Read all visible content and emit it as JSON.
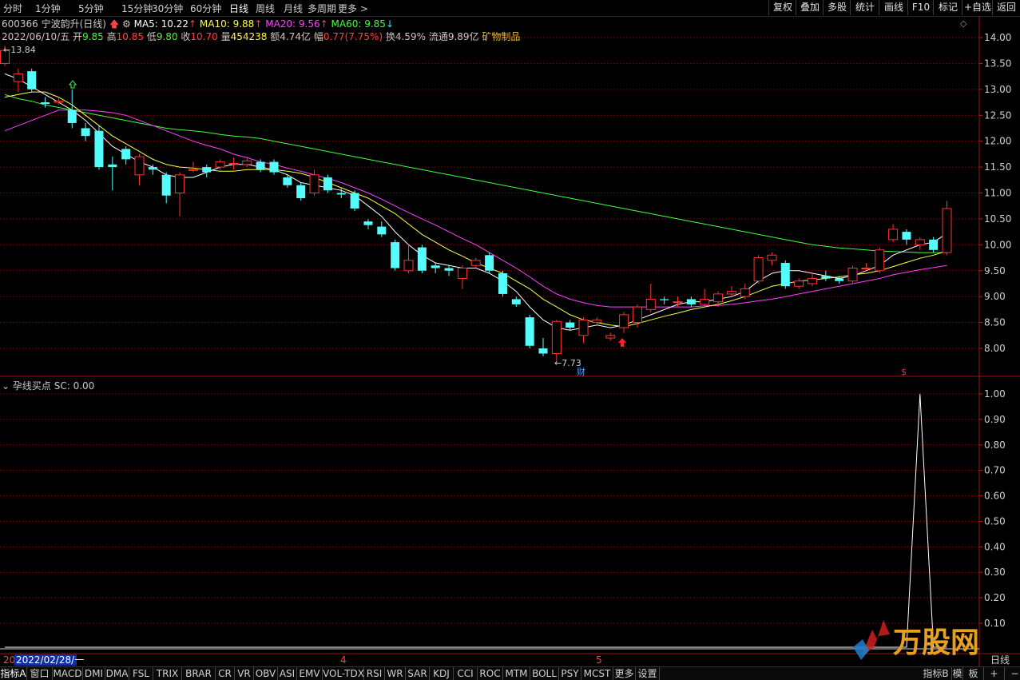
{
  "timeframes": [
    "分时",
    "1分钟",
    "5分钟",
    "15分钟",
    "30分钟",
    "60分钟",
    "日线",
    "周线",
    "月线",
    "多周期",
    "更多 >"
  ],
  "active_timeframe": "日线",
  "right_buttons": [
    "复权",
    "叠加",
    "多股",
    "统计",
    "画线",
    "F10",
    "标记",
    "+自选",
    "返回"
  ],
  "stock": {
    "code_name": "600366 宁波韵升(日线)",
    "ma5": "MA5: 10.22",
    "ma10": "MA10: 9.88",
    "ma20": "MA20: 9.56",
    "ma60": "MA60: 9.85",
    "date": "2022/06/10/五",
    "open_label": "开",
    "open": "9.85",
    "high_label": "高",
    "high": "10.85",
    "low_label": "低",
    "low": "9.80",
    "close_label": "收",
    "close": "10.70",
    "vol_label": "量",
    "vol": "454238",
    "amount_label": "额",
    "amount": "4.74亿",
    "change_label": "幅",
    "change": "0.77(7.75%)",
    "turnover_label": "换",
    "turnover": "4.59%",
    "float_label": "流通",
    "float": "9.89亿",
    "industry": "矿物制品"
  },
  "colors": {
    "up": "#ff3232",
    "down": "#54fcfc",
    "ma5": "#ffffff",
    "ma10": "#ffff40",
    "ma20": "#ff40ff",
    "ma60": "#40ff40",
    "grid": "#8b0000"
  },
  "price_axis": [
    "14.00",
    "13.50",
    "13.00",
    "12.50",
    "12.00",
    "11.50",
    "11.00",
    "10.50",
    "10.00",
    "9.50",
    "9.00",
    "8.50",
    "8.00"
  ],
  "annotations": {
    "high_mark": "13.84",
    "low_mark": "7.73",
    "cai": "财",
    "dollar": "$"
  },
  "indicator": {
    "name": "孕线买点",
    "value_text": "SC: 0.00"
  },
  "indicator_axis": [
    "1.00",
    "0.90",
    "0.80",
    "0.70",
    "0.60",
    "0.50",
    "0.40",
    "0.30",
    "0.20",
    "0.10"
  ],
  "time_axis": {
    "start_left": "20",
    "start_date": "2022/02/28/一",
    "month4": "4",
    "month5": "5",
    "end_label": "日线"
  },
  "tabs": [
    "指标A",
    "窗口",
    "MACD",
    "DMI",
    "DMA",
    "FSL",
    "TRIX",
    "BRAR",
    "CR",
    "VR",
    "OBV",
    "ASI",
    "EMV",
    "VOL-TDX",
    "RSI",
    "WR",
    "SAR",
    "KDJ",
    "CCI",
    "ROC",
    "MTM",
    "BOLL",
    "PSY",
    "MCST",
    "更多",
    "设置"
  ],
  "right_tabs": [
    "指标B",
    "模",
    "板",
    "+",
    "−"
  ],
  "watermark": "万股网",
  "chart_data": {
    "type": "candlestick",
    "candles": [
      {
        "o": 13.5,
        "c": 13.75,
        "h": 13.84,
        "l": 13.45
      },
      {
        "o": 13.15,
        "c": 13.3,
        "h": 13.4,
        "l": 12.95
      },
      {
        "o": 13.35,
        "c": 13.0,
        "h": 13.4,
        "l": 12.95
      },
      {
        "o": 12.75,
        "c": 12.72,
        "h": 12.85,
        "l": 12.65
      },
      {
        "o": 12.75,
        "c": 12.77,
        "h": 12.85,
        "l": 12.7
      },
      {
        "o": 12.6,
        "c": 12.35,
        "h": 13.0,
        "l": 12.25
      },
      {
        "o": 12.25,
        "c": 12.1,
        "h": 12.35,
        "l": 12.0
      },
      {
        "o": 12.2,
        "c": 11.5,
        "h": 12.3,
        "l": 11.45
      },
      {
        "o": 11.55,
        "c": 11.5,
        "h": 11.7,
        "l": 11.05
      },
      {
        "o": 11.85,
        "c": 11.65,
        "h": 11.9,
        "l": 11.55
      },
      {
        "o": 11.35,
        "c": 11.7,
        "h": 11.75,
        "l": 11.15
      },
      {
        "o": 11.5,
        "c": 11.45,
        "h": 11.55,
        "l": 11.35
      },
      {
        "o": 11.35,
        "c": 10.95,
        "h": 11.4,
        "l": 10.8
      },
      {
        "o": 11.0,
        "c": 11.35,
        "h": 11.4,
        "l": 10.55
      },
      {
        "o": 11.45,
        "c": 11.45,
        "h": 11.6,
        "l": 11.4
      },
      {
        "o": 11.5,
        "c": 11.4,
        "h": 11.55,
        "l": 11.3
      },
      {
        "o": 11.5,
        "c": 11.6,
        "h": 11.65,
        "l": 11.45
      },
      {
        "o": 11.57,
        "c": 11.57,
        "h": 11.68,
        "l": 11.45
      },
      {
        "o": 11.55,
        "c": 11.62,
        "h": 11.7,
        "l": 11.5
      },
      {
        "o": 11.6,
        "c": 11.45,
        "h": 11.65,
        "l": 11.4
      },
      {
        "o": 11.6,
        "c": 11.4,
        "h": 11.65,
        "l": 11.35
      },
      {
        "o": 11.3,
        "c": 11.15,
        "h": 11.35,
        "l": 11.1
      },
      {
        "o": 11.15,
        "c": 10.9,
        "h": 11.2,
        "l": 10.85
      },
      {
        "o": 11.0,
        "c": 11.35,
        "h": 11.45,
        "l": 10.95
      },
      {
        "o": 11.3,
        "c": 11.05,
        "h": 11.35,
        "l": 11.0
      },
      {
        "o": 11.0,
        "c": 10.97,
        "h": 11.1,
        "l": 10.9
      },
      {
        "o": 11.0,
        "c": 10.7,
        "h": 11.05,
        "l": 10.65
      },
      {
        "o": 10.45,
        "c": 10.38,
        "h": 10.5,
        "l": 10.3
      },
      {
        "o": 10.35,
        "c": 10.2,
        "h": 10.45,
        "l": 10.15
      },
      {
        "o": 10.05,
        "c": 9.55,
        "h": 10.1,
        "l": 9.5
      },
      {
        "o": 9.5,
        "c": 9.7,
        "h": 10.0,
        "l": 9.45
      },
      {
        "o": 9.95,
        "c": 9.5,
        "h": 10.0,
        "l": 9.45
      },
      {
        "o": 9.6,
        "c": 9.55,
        "h": 9.65,
        "l": 9.45
      },
      {
        "o": 9.55,
        "c": 9.5,
        "h": 9.6,
        "l": 9.4
      },
      {
        "o": 9.35,
        "c": 9.55,
        "h": 9.6,
        "l": 9.15
      },
      {
        "o": 9.6,
        "c": 9.7,
        "h": 9.75,
        "l": 9.55
      },
      {
        "o": 9.8,
        "c": 9.5,
        "h": 9.85,
        "l": 9.45
      },
      {
        "o": 9.45,
        "c": 9.05,
        "h": 9.5,
        "l": 9.0
      },
      {
        "o": 8.95,
        "c": 8.85,
        "h": 9.0,
        "l": 8.8
      },
      {
        "o": 8.6,
        "c": 8.05,
        "h": 8.65,
        "l": 8.0
      },
      {
        "o": 8.0,
        "c": 7.9,
        "h": 8.2,
        "l": 7.85
      },
      {
        "o": 7.9,
        "c": 8.52,
        "h": 8.55,
        "l": 7.73
      },
      {
        "o": 8.5,
        "c": 8.4,
        "h": 8.55,
        "l": 8.35
      },
      {
        "o": 8.25,
        "c": 8.55,
        "h": 8.6,
        "l": 8.1
      },
      {
        "o": 8.5,
        "c": 8.55,
        "h": 8.6,
        "l": 8.45
      },
      {
        "o": 8.2,
        "c": 8.25,
        "h": 8.3,
        "l": 8.15
      },
      {
        "o": 8.4,
        "c": 8.65,
        "h": 8.7,
        "l": 8.3
      },
      {
        "o": 8.5,
        "c": 8.8,
        "h": 8.85,
        "l": 8.4
      },
      {
        "o": 8.75,
        "c": 8.95,
        "h": 9.25,
        "l": 8.7
      },
      {
        "o": 8.95,
        "c": 8.93,
        "h": 9.0,
        "l": 8.85
      },
      {
        "o": 8.9,
        "c": 8.9,
        "h": 9.0,
        "l": 8.8
      },
      {
        "o": 8.95,
        "c": 8.85,
        "h": 9.0,
        "l": 8.8
      },
      {
        "o": 8.85,
        "c": 8.95,
        "h": 9.15,
        "l": 8.8
      },
      {
        "o": 8.9,
        "c": 9.05,
        "h": 9.1,
        "l": 8.8
      },
      {
        "o": 9.05,
        "c": 9.1,
        "h": 9.2,
        "l": 9.0
      },
      {
        "o": 9.0,
        "c": 9.15,
        "h": 9.25,
        "l": 8.95
      },
      {
        "o": 9.3,
        "c": 9.75,
        "h": 9.8,
        "l": 9.25
      },
      {
        "o": 9.7,
        "c": 9.8,
        "h": 9.85,
        "l": 9.6
      },
      {
        "o": 9.65,
        "c": 9.2,
        "h": 9.7,
        "l": 9.15
      },
      {
        "o": 9.2,
        "c": 9.3,
        "h": 9.35,
        "l": 9.15
      },
      {
        "o": 9.25,
        "c": 9.35,
        "h": 9.45,
        "l": 9.2
      },
      {
        "o": 9.4,
        "c": 9.35,
        "h": 9.5,
        "l": 9.3
      },
      {
        "o": 9.35,
        "c": 9.3,
        "h": 9.4,
        "l": 9.25
      },
      {
        "o": 9.3,
        "c": 9.55,
        "h": 9.6,
        "l": 9.25
      },
      {
        "o": 9.55,
        "c": 9.55,
        "h": 9.65,
        "l": 9.5
      },
      {
        "o": 9.5,
        "c": 9.9,
        "h": 9.95,
        "l": 9.45
      },
      {
        "o": 10.1,
        "c": 10.3,
        "h": 10.4,
        "l": 10.05
      },
      {
        "o": 10.25,
        "c": 10.1,
        "h": 10.3,
        "l": 10.0
      },
      {
        "o": 10.0,
        "c": 10.1,
        "h": 10.15,
        "l": 9.9
      },
      {
        "o": 10.1,
        "c": 9.9,
        "h": 10.15,
        "l": 9.85
      },
      {
        "o": 9.85,
        "c": 10.7,
        "h": 10.85,
        "l": 9.8
      }
    ],
    "ma5": [
      13.3,
      13.2,
      13.05,
      12.9,
      12.75,
      12.6,
      12.4,
      12.15,
      11.9,
      11.75,
      11.6,
      11.5,
      11.35,
      11.3,
      11.3,
      11.4,
      11.5,
      11.55,
      11.55,
      11.5,
      11.45,
      11.35,
      11.2,
      11.15,
      11.1,
      11.05,
      10.95,
      10.75,
      10.55,
      10.25,
      10.0,
      9.8,
      9.65,
      9.6,
      9.55,
      9.55,
      9.45,
      9.3,
      9.1,
      8.8,
      8.55,
      8.4,
      8.35,
      8.4,
      8.45,
      8.4,
      8.45,
      8.55,
      8.65,
      8.75,
      8.85,
      8.9,
      8.9,
      8.95,
      9.0,
      9.1,
      9.3,
      9.45,
      9.5,
      9.5,
      9.45,
      9.4,
      9.35,
      9.4,
      9.5,
      9.6,
      9.8,
      9.9,
      10.0,
      10.05,
      10.22
    ],
    "ma10": [
      12.85,
      12.9,
      12.95,
      12.95,
      12.85,
      12.7,
      12.5,
      12.3,
      12.1,
      11.95,
      11.8,
      11.65,
      11.55,
      11.5,
      11.48,
      11.45,
      11.42,
      11.42,
      11.45,
      11.45,
      11.45,
      11.42,
      11.38,
      11.3,
      11.2,
      11.1,
      11.0,
      10.9,
      10.75,
      10.6,
      10.4,
      10.2,
      10.05,
      9.9,
      9.78,
      9.65,
      9.55,
      9.45,
      9.3,
      9.15,
      8.95,
      8.8,
      8.65,
      8.55,
      8.5,
      8.45,
      8.42,
      8.48,
      8.55,
      8.62,
      8.68,
      8.75,
      8.8,
      8.85,
      8.92,
      9.0,
      9.1,
      9.2,
      9.25,
      9.3,
      9.32,
      9.35,
      9.38,
      9.42,
      9.45,
      9.5,
      9.58,
      9.66,
      9.74,
      9.8,
      9.88
    ],
    "ma20": [
      12.2,
      12.3,
      12.4,
      12.5,
      12.6,
      12.6,
      12.6,
      12.58,
      12.55,
      12.5,
      12.4,
      12.3,
      12.2,
      12.1,
      12.0,
      11.92,
      11.85,
      11.75,
      11.68,
      11.6,
      11.55,
      11.48,
      11.42,
      11.35,
      11.28,
      11.2,
      11.1,
      11.0,
      10.88,
      10.75,
      10.62,
      10.5,
      10.38,
      10.25,
      10.12,
      10.0,
      9.85,
      9.7,
      9.55,
      9.38,
      9.2,
      9.05,
      8.95,
      8.88,
      8.83,
      8.8,
      8.8,
      8.8,
      8.8,
      8.8,
      8.8,
      8.8,
      8.82,
      8.83,
      8.85,
      8.88,
      8.92,
      8.95,
      9.0,
      9.05,
      9.1,
      9.15,
      9.2,
      9.25,
      9.3,
      9.35,
      9.42,
      9.47,
      9.52,
      9.56,
      9.6
    ],
    "ma60": [
      12.9,
      12.82,
      12.77,
      12.7,
      12.65,
      12.6,
      12.55,
      12.5,
      12.45,
      12.4,
      12.35,
      12.3,
      12.25,
      12.22,
      12.2,
      12.17,
      12.13,
      12.1,
      12.08,
      12.05,
      12.0,
      11.95,
      11.9,
      11.85,
      11.8,
      11.75,
      11.7,
      11.65,
      11.6,
      11.55,
      11.5,
      11.45,
      11.4,
      11.35,
      11.3,
      11.25,
      11.2,
      11.15,
      11.1,
      11.05,
      11.0,
      10.95,
      10.9,
      10.85,
      10.8,
      10.75,
      10.7,
      10.65,
      10.6,
      10.55,
      10.5,
      10.45,
      10.4,
      10.35,
      10.3,
      10.25,
      10.2,
      10.15,
      10.1,
      10.05,
      10.0,
      9.97,
      9.94,
      9.92,
      9.9,
      9.88,
      9.87,
      9.86,
      9.85,
      9.85,
      9.85
    ],
    "indicator": [
      0,
      0,
      0,
      0,
      0,
      0,
      0,
      0,
      0,
      0,
      0,
      0,
      0,
      0,
      0,
      0,
      0,
      0,
      0,
      0,
      0,
      0,
      0,
      0,
      0,
      0,
      0,
      0,
      0,
      0,
      0,
      0,
      0,
      0,
      0,
      0,
      0,
      0,
      0,
      0,
      0,
      0,
      0,
      0,
      0,
      0,
      0,
      0,
      0,
      0,
      0,
      0,
      0,
      0,
      0,
      0,
      0,
      0,
      0,
      0,
      0,
      0,
      0,
      0,
      0,
      0,
      0,
      0,
      1,
      0,
      0
    ],
    "price_range": [
      7.6,
      14.2
    ],
    "indicator_range": [
      0,
      1.05
    ],
    "grid": true
  }
}
